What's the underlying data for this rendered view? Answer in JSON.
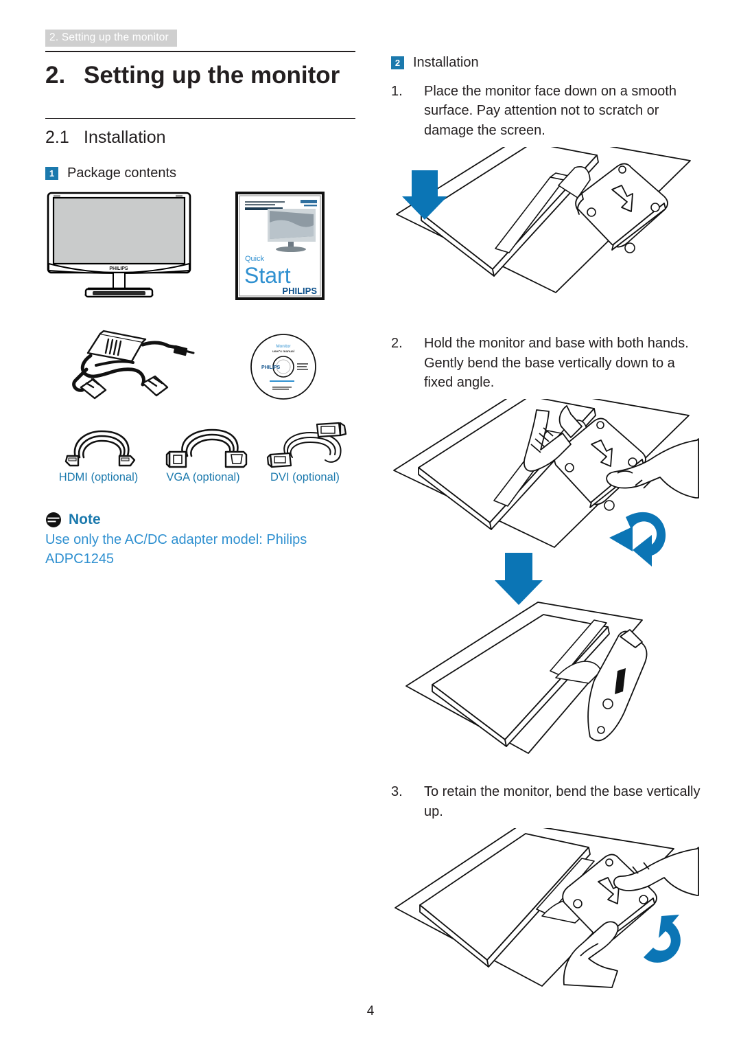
{
  "document": {
    "running_header": "2. Setting up the monitor",
    "page_number": "4"
  },
  "chapter": {
    "number": "2.",
    "title": "Setting up the monitor"
  },
  "section": {
    "number": "2.1",
    "title": "Installation"
  },
  "left_column": {
    "subsection": {
      "badge": "1",
      "label": "Package contents"
    },
    "package_items": [
      {
        "name": "monitor",
        "label": ""
      },
      {
        "name": "quick-start-guide",
        "label": ""
      },
      {
        "name": "ac-dc-adapter-power-cable",
        "label": ""
      },
      {
        "name": "cd-user-manual",
        "label": ""
      },
      {
        "name": "hdmi-cable",
        "label": "HDMI (optional)"
      },
      {
        "name": "vga-cable",
        "label": "VGA (optional)"
      },
      {
        "name": "dvi-cable",
        "label": "DVI (optional)"
      }
    ],
    "cable_labels": [
      "HDMI (optional)",
      "VGA (optional)",
      "DVI (optional)"
    ],
    "quick_start": {
      "word_quick": "Quick",
      "word_start": "Start",
      "brand": "PHILIPS"
    },
    "cd": {
      "line1": "Monitor",
      "line2": "user's manual",
      "brand": "PHILIPS"
    },
    "monitor_brand": "PHILIPS",
    "note": {
      "title": "Note",
      "body": "Use only the AC/DC adapter model: Philips ADPC1245"
    }
  },
  "right_column": {
    "subsection": {
      "badge": "2",
      "label": "Installation"
    },
    "steps": [
      {
        "number": "1.",
        "text": "Place the monitor face down on a smooth surface. Pay attention not to scratch or damage the screen."
      },
      {
        "number": "2.",
        "text": "Hold the monitor and base with both hands. Gently bend the base vertically down to a fixed angle."
      },
      {
        "number": "3.",
        "text": "To retain the monitor, bend the base vertically up."
      }
    ]
  },
  "colors": {
    "accent_blue": "#1b79ad",
    "arrow_blue": "#0b75b5",
    "note_text_blue": "#2f90d0",
    "header_bar_gray": "#cfcfcf",
    "ink": "#231f20"
  }
}
